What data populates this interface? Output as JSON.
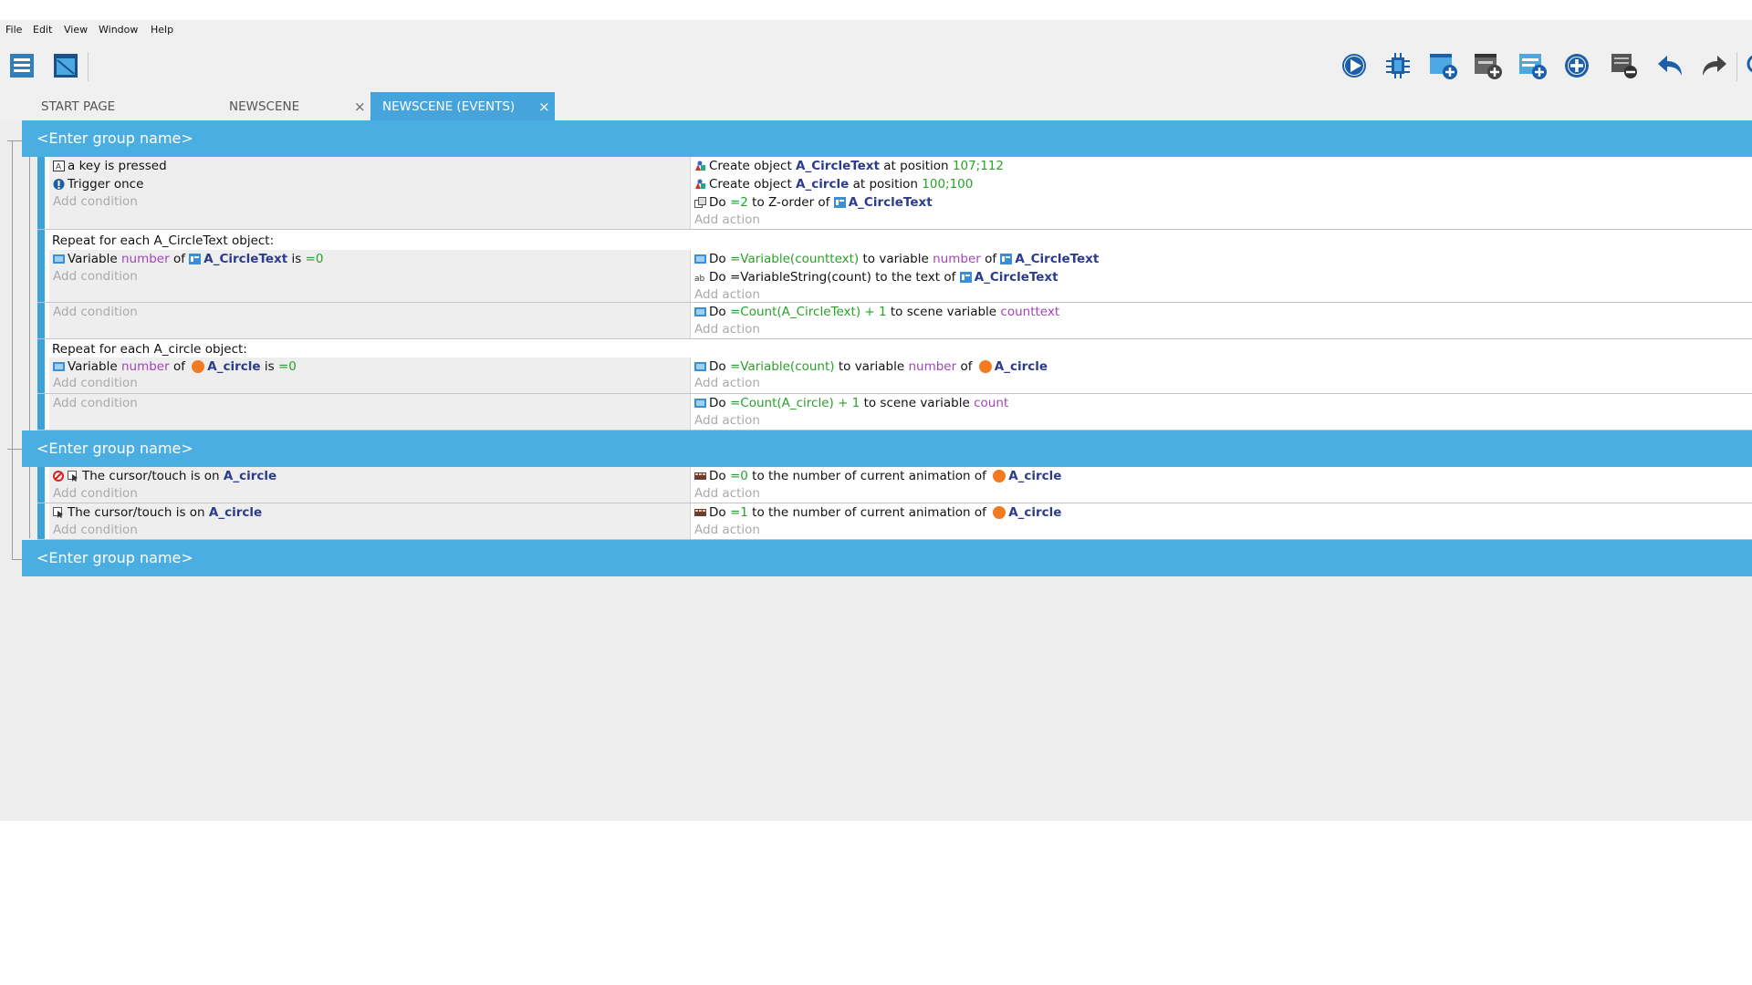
{
  "menu": [
    "File",
    "Edit",
    "View",
    "Window",
    "Help"
  ],
  "toolbar": {
    "left_icons": [
      "project-manager-icon",
      "scene-icon"
    ],
    "right_icons": [
      "preview-icon",
      "debug-icon",
      "add-event-icon",
      "add-sub-event-icon",
      "add-comment-icon",
      "add-group-icon",
      "delete-icon",
      "undo-icon",
      "redo-icon",
      "search-icon"
    ]
  },
  "tabs": [
    {
      "label": "START PAGE"
    },
    {
      "label": "NEWSCENE",
      "close": "×"
    },
    {
      "label": "NEWSCENE (EVENTS)",
      "close": "×",
      "active": true
    }
  ],
  "placeholders": {
    "add_condition": "Add condition",
    "add_action": "Add action"
  },
  "groups": [
    {
      "name": "<Enter group name>"
    },
    {
      "name": "<Enter group name>"
    },
    {
      "name": "<Enter group name>"
    }
  ],
  "event1": {
    "conditions": [
      "a key is pressed",
      "Trigger once"
    ],
    "actions": {
      "a1": {
        "pre": "Create object",
        "obj": "A_CircleText",
        "mid": "at position",
        "val": "107;112"
      },
      "a2": {
        "pre": "Create object",
        "obj": "A_circle",
        "mid": "at position",
        "val": "100;100"
      },
      "a3": {
        "pre": "Do",
        "val": "=2",
        "mid": "to Z-order of",
        "obj": "A_CircleText"
      }
    }
  },
  "repeat1": {
    "label": "Repeat for each A_CircleText object:",
    "condition": {
      "pre": "Variable",
      "var": "number",
      "of": "of",
      "obj": "A_CircleText",
      "is": "is",
      "val": "=0"
    },
    "actions": {
      "a1": {
        "pre": "Do",
        "expr": "=Variable(counttext)",
        "mid": "to variable",
        "var": "number",
        "of": "of",
        "obj": "A_CircleText"
      },
      "a2": {
        "pre": "Do",
        "expr": "=VariableString(count)",
        "mid": "to the text of",
        "obj": "A_CircleText"
      }
    }
  },
  "sub1": {
    "action": {
      "pre": "Do",
      "expr": "=Count(A_CircleText) + 1",
      "mid": "to scene variable",
      "var": "counttext"
    }
  },
  "repeat2": {
    "label": "Repeat for each A_circle object:",
    "condition": {
      "pre": "Variable",
      "var": "number",
      "of": "of",
      "obj": "A_circle",
      "is": "is",
      "val": "=0"
    },
    "action": {
      "pre": "Do",
      "expr": "=Variable(count)",
      "mid": "to variable",
      "var": "number",
      "of": "of",
      "obj": "A_circle"
    }
  },
  "sub2": {
    "action": {
      "pre": "Do",
      "expr": "=Count(A_circle) + 1",
      "mid": "to scene variable",
      "var": "count"
    }
  },
  "event_g2a": {
    "condition": {
      "pre": "The cursor/touch is on",
      "obj": "A_circle"
    },
    "action": {
      "pre": "Do",
      "val": "=0",
      "mid": "to the number of current animation of",
      "obj": "A_circle"
    }
  },
  "event_g2b": {
    "condition": {
      "pre": "The cursor/touch is on",
      "obj": "A_circle"
    },
    "action": {
      "pre": "Do",
      "val": "=1",
      "mid": "to the number of current animation of",
      "obj": "A_circle"
    }
  },
  "colors": {
    "group_header": "#4aaee2",
    "active_tab": "#44a4db",
    "object": "#2b3c8b",
    "expression": "#2aa12a",
    "variable": "#a245b6",
    "circle": "#f27a21"
  }
}
